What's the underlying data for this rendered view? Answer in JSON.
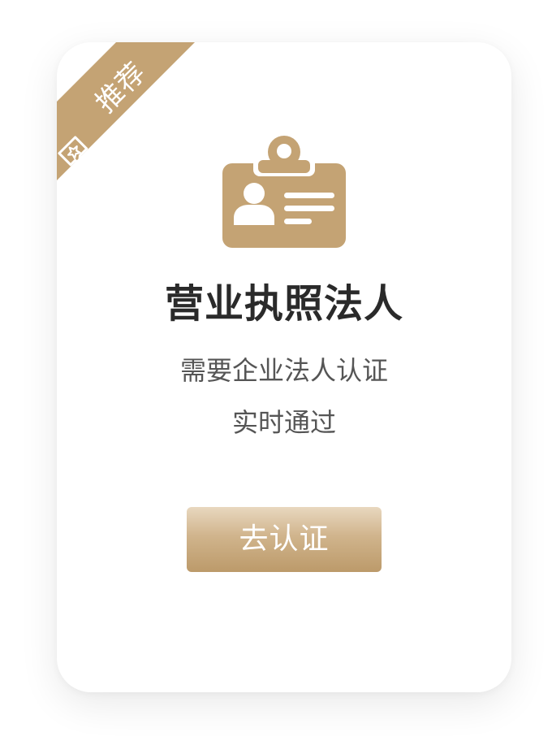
{
  "ribbon": {
    "label": "推荐",
    "icon": "recommend-badge-icon",
    "color": "#c4a374"
  },
  "card": {
    "icon": "id-card-icon",
    "icon_color": "#c4a374",
    "title": "营业执照法人",
    "description_line1": "需要企业法人认证",
    "description_line2": "实时通过",
    "button_label": "去认证"
  }
}
